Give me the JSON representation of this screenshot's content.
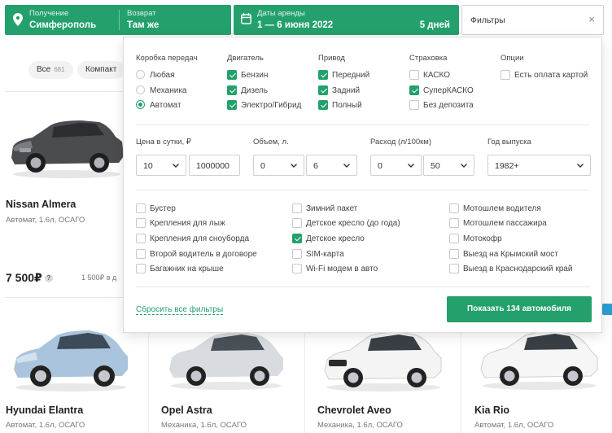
{
  "search": {
    "pickup_label": "Получение",
    "pickup_value": "Симферополь",
    "return_label": "Возврат",
    "return_value": "Там же",
    "dates_label": "Даты аренды",
    "dates_value": "1 — 6 июня 2022",
    "days_value": "5 дней",
    "filters_label": "Фильтры",
    "filters_close": "×"
  },
  "chips": [
    {
      "label": "Все",
      "count": "681"
    },
    {
      "label": "Компакт",
      "count": ""
    }
  ],
  "cars": [
    {
      "name": "Nissan Almera",
      "spec": "Автомат, 1.6л, ОСАГО",
      "price": "7 500₽",
      "price_note": "1 500₽ в д"
    },
    {
      "name": "Hyundai Elantra",
      "spec": "Автомат, 1.6л, ОСАГО"
    },
    {
      "name": "Opel Astra",
      "spec": "Механика, 1.6л, ОСАГО"
    },
    {
      "name": "Chevrolet Aveo",
      "spec": "Механика, 1.6л, ОСАГО"
    },
    {
      "name": "Kia Rio",
      "spec": "Автомат, 1.6л, ОСАГО"
    }
  ],
  "filters": {
    "transmission": {
      "title": "Коробка передач",
      "options": [
        {
          "label": "Любая",
          "selected": false
        },
        {
          "label": "Механика",
          "selected": false
        },
        {
          "label": "Автомат",
          "selected": true
        }
      ]
    },
    "engine": {
      "title": "Двигатель",
      "options": [
        {
          "label": "Бензин",
          "checked": true
        },
        {
          "label": "Дизель",
          "checked": true
        },
        {
          "label": "Электро/Гибрид",
          "checked": true
        }
      ]
    },
    "drive": {
      "title": "Привод",
      "options": [
        {
          "label": "Передний",
          "checked": true
        },
        {
          "label": "Задний",
          "checked": true
        },
        {
          "label": "Полный",
          "checked": true
        }
      ]
    },
    "insurance": {
      "title": "Страховка",
      "options": [
        {
          "label": "КАСКО",
          "checked": false
        },
        {
          "label": "СуперКАСКО",
          "checked": true
        },
        {
          "label": "Без депозита",
          "checked": false
        }
      ]
    },
    "extras_options": {
      "title": "Опции",
      "options": [
        {
          "label": "Есть оплата картой",
          "checked": false
        }
      ]
    },
    "price": {
      "title": "Цена в сутки, ₽",
      "from": "10",
      "to": "1000000"
    },
    "volume": {
      "title": "Объем, л.",
      "from": "0",
      "to": "6"
    },
    "consumption": {
      "title": "Расход (л/100км)",
      "from": "0",
      "to": "50"
    },
    "year": {
      "title": "Год выпуска",
      "value": "1982+"
    },
    "extras": [
      {
        "label": "Бустер",
        "checked": false
      },
      {
        "label": "Крепления для лыж",
        "checked": false
      },
      {
        "label": "Крепления для сноуборда",
        "checked": false
      },
      {
        "label": "Второй водитель в договоре",
        "checked": false
      },
      {
        "label": "Багажник на крыше",
        "checked": false
      },
      {
        "label": "Зимний пакет",
        "checked": false
      },
      {
        "label": "Детское кресло (до года)",
        "checked": false
      },
      {
        "label": "Детское кресло",
        "checked": true
      },
      {
        "label": "SIM-карта",
        "checked": false
      },
      {
        "label": "Wi-Fi модем в авто",
        "checked": false
      },
      {
        "label": "Мотошлем водителя",
        "checked": false
      },
      {
        "label": "Мотошлем пассажира",
        "checked": false
      },
      {
        "label": "Мотокофр",
        "checked": false
      },
      {
        "label": "Выезд на Крымский мост",
        "checked": false
      },
      {
        "label": "Выезд в Краснодарский край",
        "checked": false
      }
    ],
    "reset_label": "Сбросить все фильтры",
    "show_label": "Показать 134 автомобиля"
  },
  "colors": {
    "accent": "#23a06b",
    "blue": "#2a9fd6"
  }
}
